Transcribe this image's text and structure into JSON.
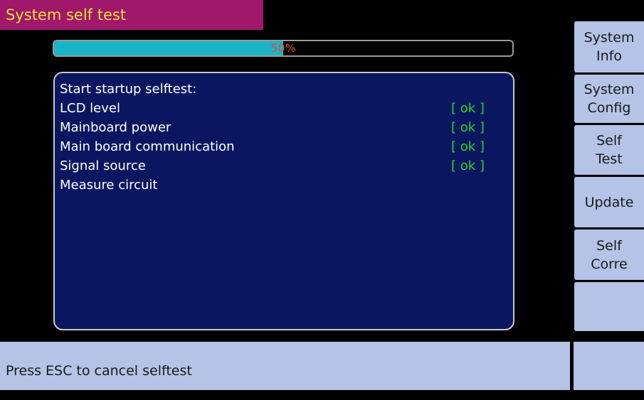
{
  "header": {
    "title": "System self test"
  },
  "progress": {
    "value": 0.5,
    "label": "50%"
  },
  "log": {
    "heading": "Start startup selftest:",
    "items": [
      {
        "name": "LCD level",
        "status": "[ ok ]"
      },
      {
        "name": "Mainboard power",
        "status": "[ ok ]"
      },
      {
        "name": "Main board communication",
        "status": "[ ok ]"
      },
      {
        "name": "Signal source",
        "status": "[ ok ]"
      },
      {
        "name": "Measure circuit",
        "status": ""
      }
    ]
  },
  "softkeys": [
    {
      "label": "System\nInfo"
    },
    {
      "label": "System\nConfig"
    },
    {
      "label": "Self\nTest"
    },
    {
      "label": "Update"
    },
    {
      "label": "Self\nCorre"
    },
    {
      "label": ""
    }
  ],
  "status_bar": {
    "message": "Press ESC to cancel selftest"
  },
  "colors": {
    "title_bg": "#a0176b",
    "title_text": "#f2e03a",
    "progress_fill": "#1ab4c8",
    "progress_text": "#e0483a",
    "panel_bg": "#0a1760",
    "ok_text": "#26d626",
    "softkey_bg": "#b4c3e6"
  }
}
